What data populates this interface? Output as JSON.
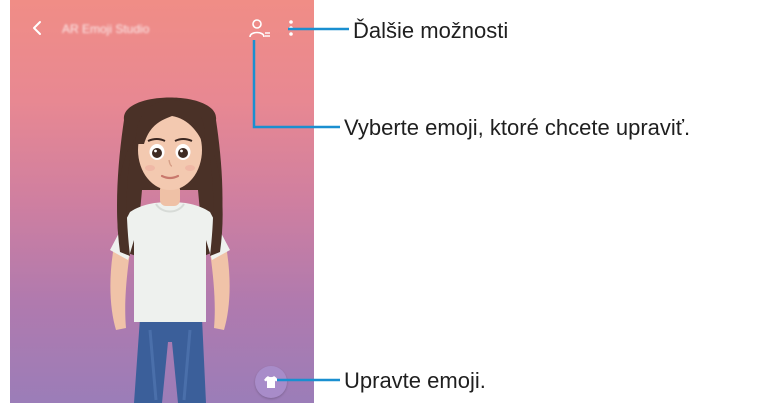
{
  "app": {
    "title": "AR Emoji Studio"
  },
  "callouts": {
    "more_options": "Ďalšie možnosti",
    "select_emoji": "Vyberte emoji, ktoré chcete upraviť.",
    "edit_emoji": "Upravte emoji."
  },
  "icons": {
    "back": "chevron-left-icon",
    "profile": "person-switch-icon",
    "more": "kebab-menu-icon",
    "edit": "t-shirt-icon"
  },
  "colors": {
    "callout_line": "#1a8fd0",
    "gradient_top": "#f08d86",
    "gradient_bottom": "#9b7db8",
    "edit_button": "#a88cc9"
  }
}
